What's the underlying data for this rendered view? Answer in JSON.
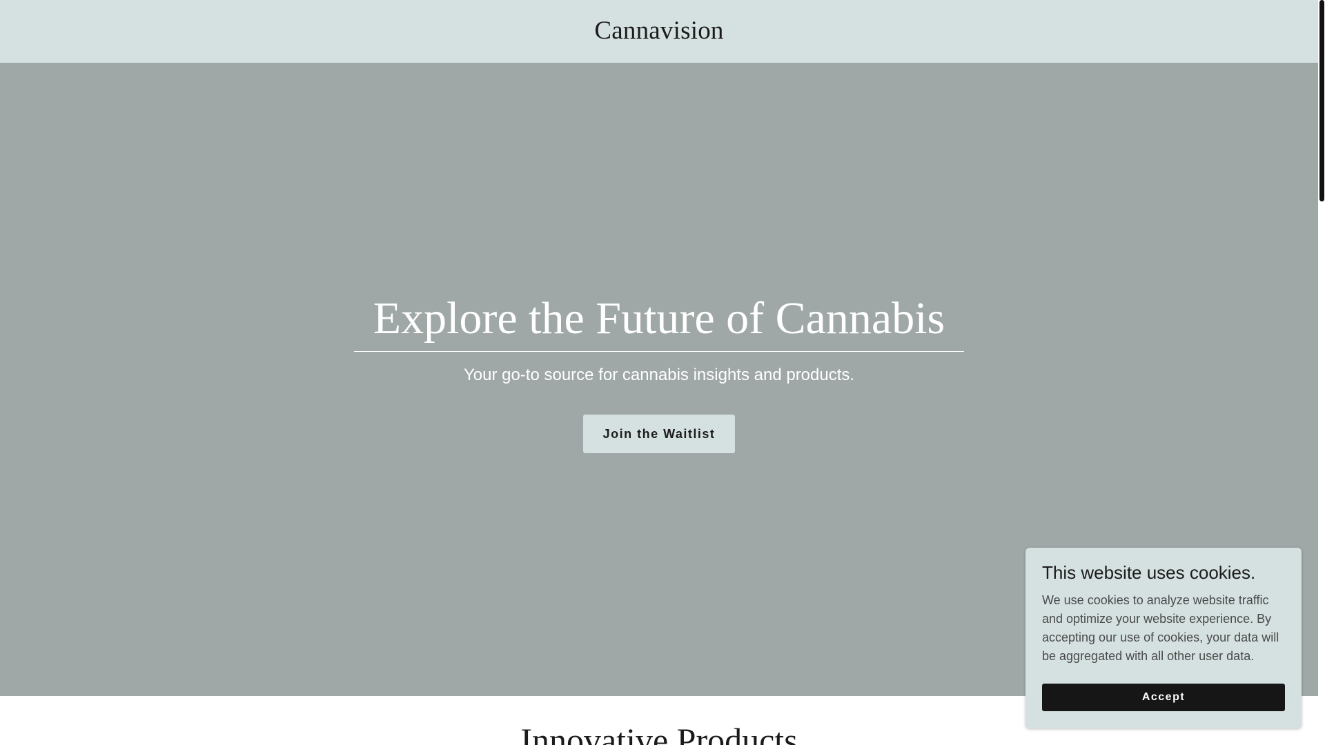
{
  "header": {
    "site_title": "Cannavision"
  },
  "hero": {
    "title": "Explore the Future of Cannabis",
    "subtitle": "Your go-to source for cannabis insights and products.",
    "cta_label": "Join the Waitlist"
  },
  "next_section": {
    "heading": "Innovative Products"
  },
  "cookie_banner": {
    "title": "This website uses cookies.",
    "body": "We use cookies to analyze website traffic and optimize your website experience. By accepting our use of cookies, your data will be aggregated with all other user data.",
    "accept_label": "Accept"
  },
  "colors": {
    "header_bg": "#d5e1e0",
    "hero_bg": "#9fa8a6",
    "accept_bg": "#161616"
  }
}
